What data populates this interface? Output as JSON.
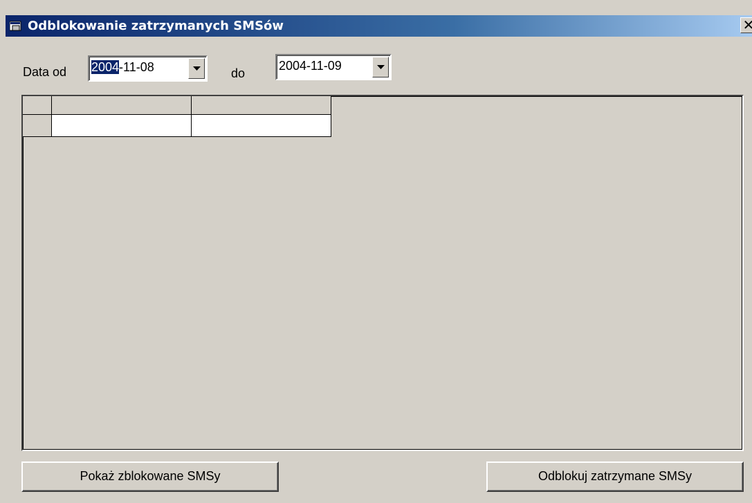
{
  "window": {
    "title": "Odblokowanie zatrzymanych SMSów",
    "close_glyph": "✕"
  },
  "filters": {
    "date_from_label": "Data od",
    "date_from": {
      "selected_part": "2004",
      "rest": "-11-08"
    },
    "date_to_label": "do",
    "date_to": "2004-11-09"
  },
  "grid": {
    "columns": [
      "",
      ""
    ],
    "rows": [
      [
        "",
        ""
      ]
    ]
  },
  "buttons": {
    "show_blocked": "Pokaż zblokowane SMSy",
    "unblock": "Odblokuj zatrzymane SMSy"
  },
  "colors": {
    "titlebar_start": "#0a246a",
    "titlebar_end": "#a6caf0",
    "face": "#d4d0c8",
    "selection": "#0a246a"
  },
  "icons": {
    "app": "window-app-icon",
    "dropdown": "dropdown-arrow-icon",
    "close": "close-icon"
  }
}
